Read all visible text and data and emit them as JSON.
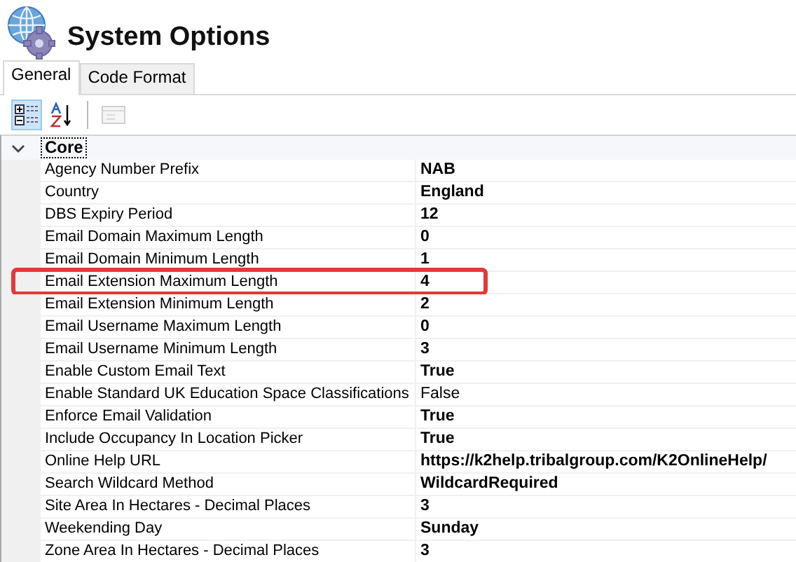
{
  "window": {
    "title": "System Options"
  },
  "tabs": [
    {
      "label": "General",
      "selected": true
    },
    {
      "label": "Code Format",
      "selected": false
    }
  ],
  "toolbar": [
    {
      "kind": "categorized",
      "selected": true
    },
    {
      "kind": "alphabetical",
      "selected": false
    },
    {
      "kind": "pages",
      "disabled": true
    }
  ],
  "category": {
    "label": "Core",
    "expanded": true
  },
  "properties": [
    {
      "name": "Agency Number Prefix",
      "value": "NAB",
      "modified": true,
      "highlighted": false
    },
    {
      "name": "Country",
      "value": "England",
      "modified": true,
      "highlighted": false
    },
    {
      "name": "DBS Expiry Period",
      "value": "12",
      "modified": true,
      "highlighted": false
    },
    {
      "name": "Email Domain Maximum Length",
      "value": "0",
      "modified": true,
      "highlighted": false
    },
    {
      "name": "Email Domain Minimum Length",
      "value": "1",
      "modified": true,
      "highlighted": false
    },
    {
      "name": "Email Extension Maximum Length",
      "value": "4",
      "modified": true,
      "highlighted": true
    },
    {
      "name": "Email Extension Minimum Length",
      "value": "2",
      "modified": true,
      "highlighted": false
    },
    {
      "name": "Email Username Maximum Length",
      "value": "0",
      "modified": true,
      "highlighted": false
    },
    {
      "name": "Email Username Minimum Length",
      "value": "3",
      "modified": true,
      "highlighted": false
    },
    {
      "name": "Enable Custom Email Text",
      "value": "True",
      "modified": true,
      "highlighted": false
    },
    {
      "name": "Enable Standard UK Education Space Classifications",
      "value": "False",
      "modified": false,
      "highlighted": false
    },
    {
      "name": "Enforce Email Validation",
      "value": "True",
      "modified": true,
      "highlighted": false
    },
    {
      "name": "Include Occupancy In Location Picker",
      "value": "True",
      "modified": true,
      "highlighted": false
    },
    {
      "name": "Online Help URL",
      "value": "https://k2help.tribalgroup.com/K2OnlineHelp/",
      "modified": true,
      "highlighted": false
    },
    {
      "name": "Search Wildcard Method",
      "value": "WildcardRequired",
      "modified": true,
      "highlighted": false
    },
    {
      "name": "Site Area In Hectares - Decimal Places",
      "value": "3",
      "modified": true,
      "highlighted": false
    },
    {
      "name": "Weekending Day",
      "value": "Sunday",
      "modified": true,
      "highlighted": false
    },
    {
      "name": "Zone Area In Hectares - Decimal Places",
      "value": "3",
      "modified": true,
      "highlighted": false
    }
  ]
}
